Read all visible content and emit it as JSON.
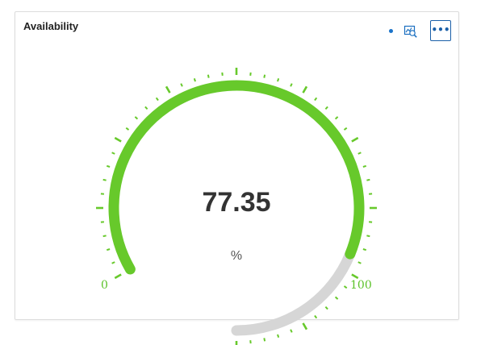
{
  "widget": {
    "title": "Availability",
    "more_label": "•••",
    "status_dot_color": "#1a73c9",
    "inspect_icon": "chart-inspect-icon",
    "more_icon": "more-options-icon"
  },
  "gauge": {
    "value_text": "77.35",
    "value": 77.35,
    "unit": "%",
    "min_label": "0",
    "max_label": "100",
    "min": 0,
    "max": 100,
    "fill_color": "#67c92b",
    "track_color": "#d6d6d6",
    "tick_color": "#67c92b"
  }
}
